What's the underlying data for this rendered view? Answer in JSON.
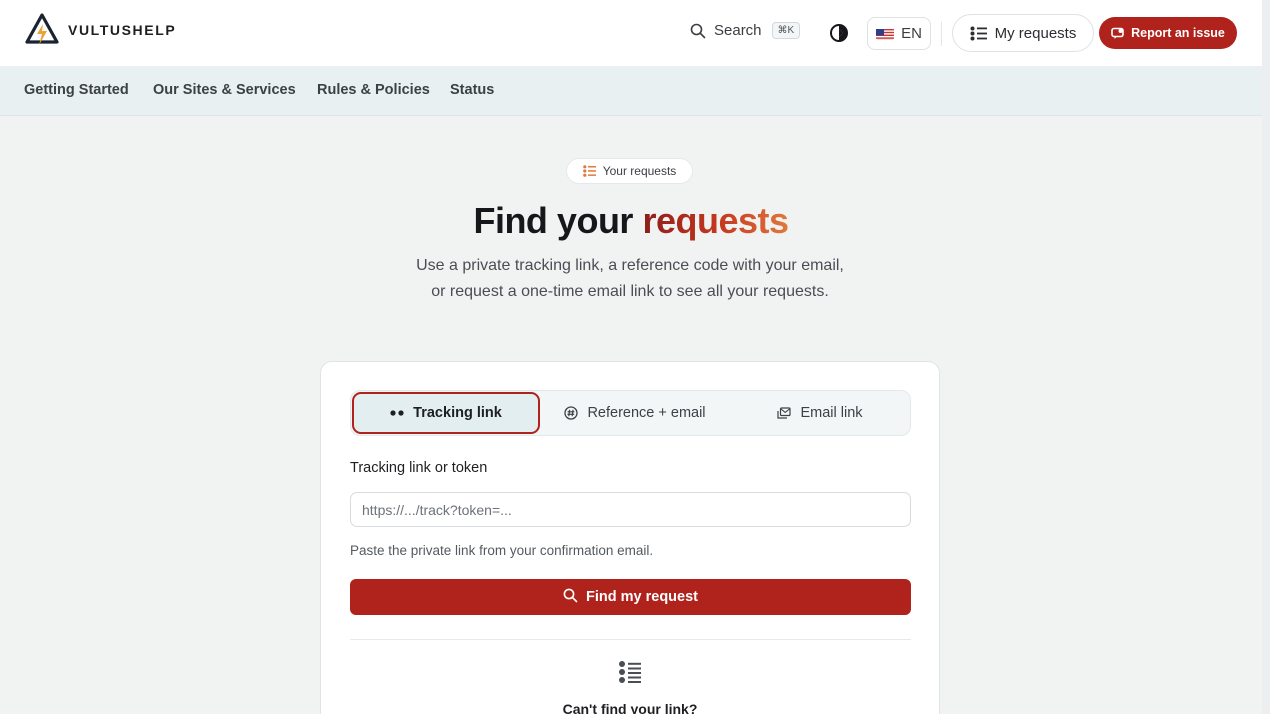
{
  "header": {
    "brand": "VULTUSHELP",
    "search_label": "Search",
    "search_shortcut": "⌘K",
    "language": "EN",
    "my_requests_label": "My requests",
    "report_label": "Report an issue"
  },
  "nav": {
    "items": [
      "Getting Started",
      "Our Sites & Services",
      "Rules & Policies",
      "Status"
    ]
  },
  "hero": {
    "badge": "Your requests",
    "title_prefix": "Find your ",
    "title_highlight": "requests",
    "subtitle": "Use a private tracking link, a reference code with your email, or request a one-time email link to see all your requests."
  },
  "form": {
    "tabs": [
      {
        "label": "Tracking link",
        "icon": "dots-icon",
        "active": true
      },
      {
        "label": "Reference + email",
        "icon": "hash-icon",
        "active": false
      },
      {
        "label": "Email link",
        "icon": "mail-stack-icon",
        "active": false
      }
    ],
    "field_label": "Tracking link or token",
    "input_placeholder": "https://.../track?token=...",
    "input_value": "",
    "hint": "Paste the private link from your confirmation email.",
    "submit_label": "Find my request",
    "cant_find": "Can't find your link?"
  },
  "colors": {
    "accent": "#b0221c",
    "nav_bg": "#e8f0f2",
    "page_bg": "#f1f3f3"
  }
}
